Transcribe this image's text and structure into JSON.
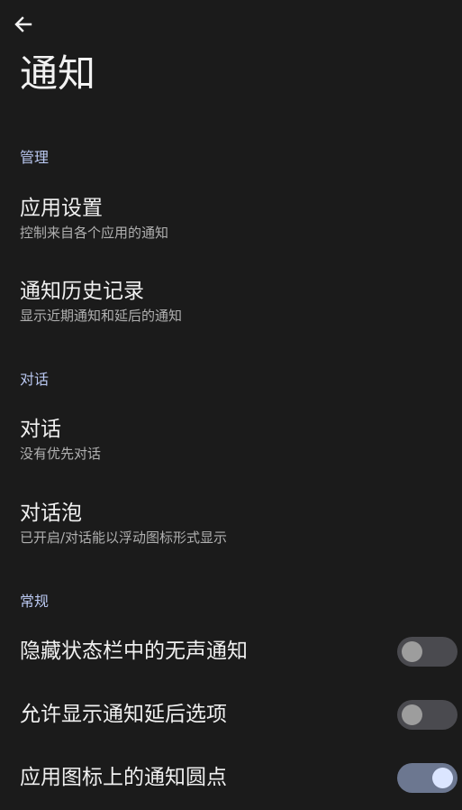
{
  "header": {
    "back_icon": "arrow-left-icon",
    "title": "通知"
  },
  "sections": {
    "manage": {
      "header": "管理",
      "app_settings": {
        "title": "应用设置",
        "subtitle": "控制来自各个应用的通知"
      },
      "history": {
        "title": "通知历史记录",
        "subtitle": "显示近期通知和延后的通知"
      }
    },
    "conversation": {
      "header": "对话",
      "conversations": {
        "title": "对话",
        "subtitle": "没有优先对话"
      },
      "bubbles": {
        "title": "对话泡",
        "subtitle": "已开启/对话能以浮动图标形式显示"
      }
    },
    "general": {
      "header": "常规",
      "toggles": [
        {
          "label": "隐藏状态栏中的无声通知",
          "checked": false
        },
        {
          "label": "允许显示通知延后选项",
          "checked": false
        },
        {
          "label": "应用图标上的通知圆点",
          "checked": true
        }
      ]
    }
  },
  "colors": {
    "background": "#1b1b1b",
    "section_header": "#b9c7f0",
    "switch_off_track": "#4a4a4f",
    "switch_on_track": "#6c7790",
    "switch_on_thumb": "#dbe5ff"
  }
}
